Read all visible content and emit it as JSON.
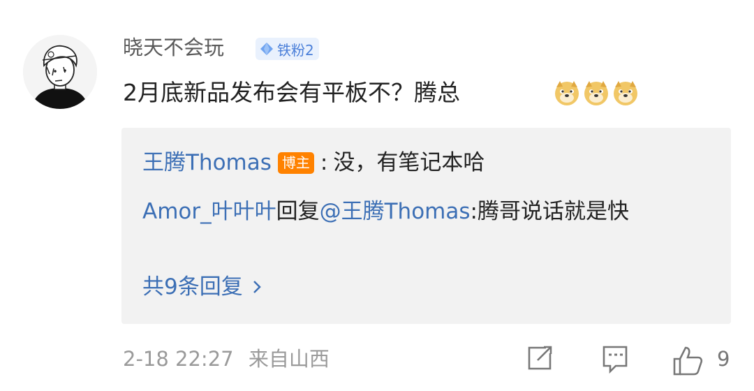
{
  "comment": {
    "username": "晓天不会玩",
    "fan_badge": "铁粉2",
    "text": "2月底新品发布会有平板不？腾总",
    "emoji_count": 3
  },
  "replies": [
    {
      "author": "王腾Thomas",
      "badge": "博主",
      "separator": ":",
      "text": "没，有笔记本哈"
    },
    {
      "author": "Amor_叶叶叶",
      "reply_word": "回复",
      "mention": "@王腾Thomas",
      "text": ":腾哥说话就是快"
    }
  ],
  "more_replies": "共9条回复",
  "meta": {
    "timestamp": "2-18 22:27",
    "source": "来自山西"
  },
  "actions": {
    "like_count": "9",
    "icons": [
      "share-icon",
      "comment-icon",
      "like-icon"
    ]
  }
}
